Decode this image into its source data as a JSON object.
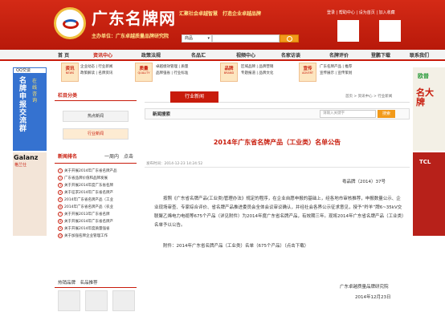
{
  "header": {
    "site_name": "广东名牌网",
    "sponsor": "主办单位：广东卓越质量品牌研究院",
    "slogan": "汇聚社会卓越智慧　打造企业卓越品牌",
    "search_select": "商品",
    "top_links": "登录 | 帮助中心 | 设为首页 | 加入收藏"
  },
  "nav": {
    "items": [
      "首 页",
      "资讯中心",
      "政策法规",
      "名品汇",
      "视频中心",
      "名家访谈",
      "名牌评价",
      "登鹏下载",
      "联系我们"
    ]
  },
  "categories": {
    "boxes": [
      {
        "title": "资讯",
        "sub": "NEWS"
      },
      {
        "title": "质量",
        "sub": "QUALITY"
      },
      {
        "title": "品牌",
        "sub": "BRAND"
      },
      {
        "title": "宣传",
        "sub": "ADVERT"
      }
    ],
    "links": [
      [
        "企业动态 | 行业新闻",
        "政策解读 | 名牌资讯"
      ],
      [
        "卓越绩效管理 | 质量",
        "品牌强省 | 行业标准"
      ],
      [
        "区域品牌 | 品牌营销",
        "专题报道 | 品牌文化"
      ],
      [
        "广东名牌产品 | 推荐",
        "宣传展示 | 宣传策划"
      ]
    ]
  },
  "ads": {
    "left_head": "QQ交谈",
    "left_text": "名牌申报交流群",
    "left_text2": "在线咨询",
    "left2_title": "Galanz",
    "left2_sub": "格兰仕",
    "right_logo": "欧普",
    "right_text": "名大牌",
    "right2_logo": "TCL"
  },
  "sidebar": {
    "title": "栏目分类",
    "menu": [
      "热点新闻",
      "行业新闻"
    ],
    "news_tabs": [
      "新闻排名",
      "一周内",
      "点击"
    ],
    "news": [
      "关于开展2014年广东省名牌产品",
      "广东省品牌价值和品牌发展",
      "关于开展2014年度广东省名牌",
      "关于征求2014年广东省名牌产",
      "2014年广东省名牌产品（工业",
      "2014年广东省名牌产品（农业",
      "关于开展2013年广东省名牌",
      "关于开展2014年广东省名牌产",
      "关于开展2014年度质量强省",
      "关于加强名牌企业管理工作"
    ],
    "hot_title": "热销品牌　名品推荐"
  },
  "main": {
    "tab": "行业新闻",
    "breadcrumb": "首页 > 资讯中心 > 行业新闻",
    "search_label": "新闻搜索",
    "search_placeholder": "请输入关键字",
    "search_btn": "搜索",
    "article": {
      "title": "2014年广东省名牌产品（工业类）名单公告",
      "meta": "发布时间：2014-12-23 14:24:52",
      "doc_no": "粤品牌（2014）37号",
      "body": "按照《广东省名牌产品(工业类)管理办法》规定的程序，在企业自愿申报的基础上，经各地市审核推荐，申报数量公示、企业现场审查、专家综合评价、省名牌产品推进委员会全体会议审议确认，并经社会各界公示征求意见，授予“羚羊”牌6~35kV交联聚乙烯电力电缆等675个产品（详见附件）为2014年度广东省名牌产品，有效期三年。现将2014年广东省名牌产品（工业类）名单予以公告。",
      "attachment": "附件：2014年广东省名牌产品（工业类）名单（675个产品）（点击下载）",
      "signer": "广东卓越质量品牌研究院",
      "date": "2014年12月23日"
    }
  }
}
